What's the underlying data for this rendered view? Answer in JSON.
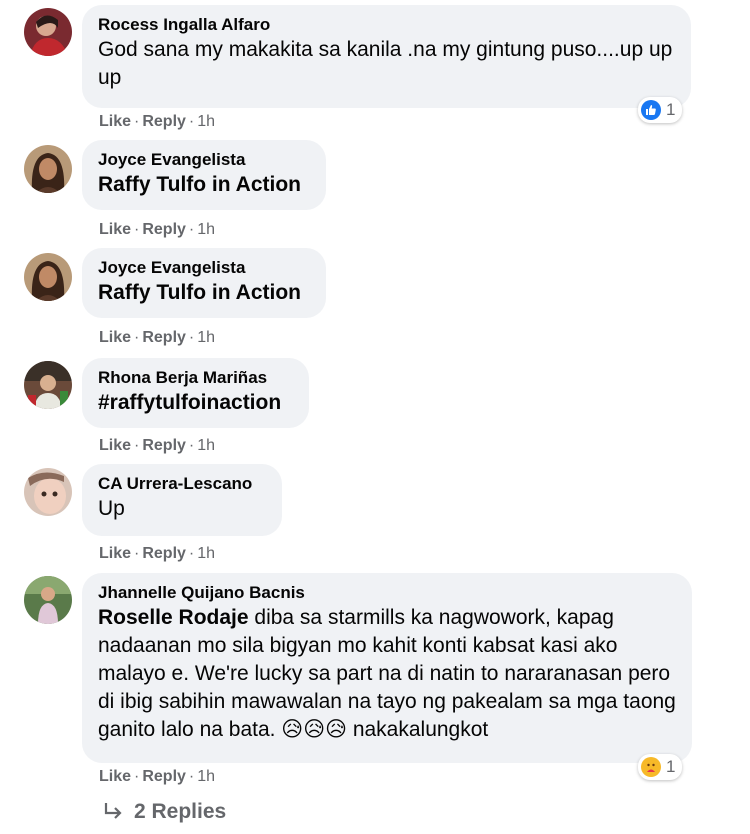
{
  "comments": [
    {
      "author": "Rocess Ingalla Alfaro",
      "text": "God sana my makakita sa kanila .na my gintung puso....up up up",
      "like": "Like",
      "reply": "Reply",
      "time": "1h",
      "reaction_count": "1"
    },
    {
      "author": "Joyce Evangelista",
      "text": "Raffy Tulfo in Action",
      "like": "Like",
      "reply": "Reply",
      "time": "1h"
    },
    {
      "author": "Joyce Evangelista",
      "text": "Raffy Tulfo in Action",
      "like": "Like",
      "reply": "Reply",
      "time": "1h"
    },
    {
      "author": "Rhona Berja Mariñas",
      "text": "#raffytulfoinaction",
      "like": "Like",
      "reply": "Reply",
      "time": "1h"
    },
    {
      "author": "CA Urrera-Lescano",
      "text": "Up",
      "like": "Like",
      "reply": "Reply",
      "time": "1h"
    },
    {
      "author": "Jhannelle Quijano Bacnis",
      "mention": "Roselle Rodaje",
      "text": " diba sa starmills ka nagwowork, kapag nadaanan mo sila bigyan mo kahit konti kabsat kasi ako malayo e. We're lucky sa part na di natin to nararanasan pero di ibig sabihin mawawalan na tayo ng pakealam sa mga taong ganito lalo na bata. 😥😥😥 nakakalungkot",
      "like": "Like",
      "reply": "Reply",
      "time": "1h",
      "reaction_count": "1"
    }
  ],
  "replies_label": "2 Replies",
  "colors": {
    "bubble": "#f0f2f5",
    "meta_text": "#65676b",
    "like_blue": "#1877f2",
    "care_yellow": "#f7b928"
  }
}
